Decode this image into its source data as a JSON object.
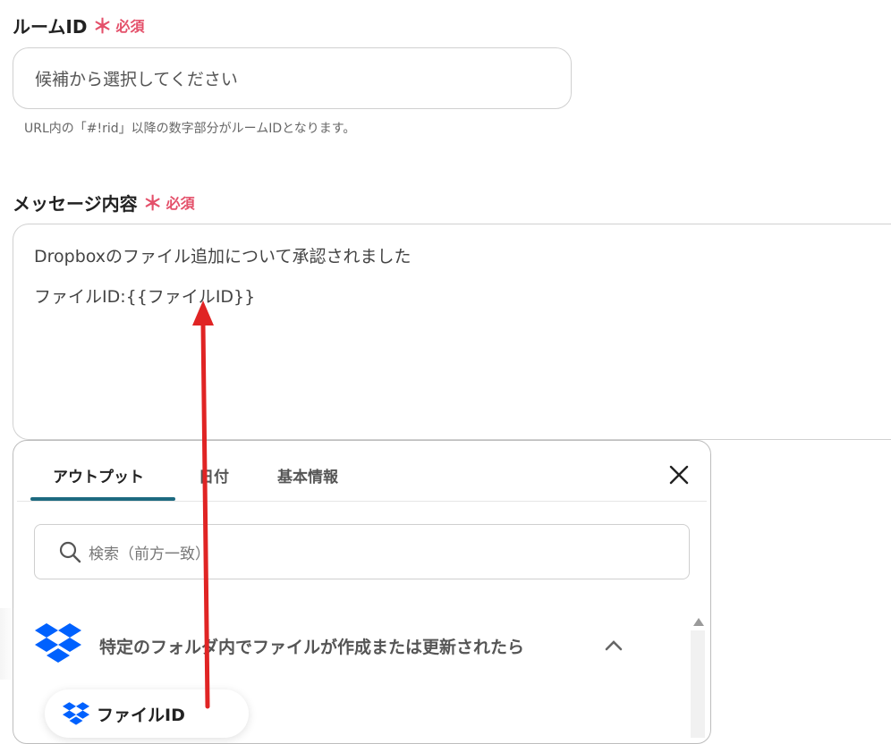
{
  "room_id": {
    "label": "ルームID",
    "required_star": "＊",
    "required_text": "必須",
    "placeholder": "候補から選択してください",
    "hint": "URL内の「#!rid」以降の数字部分がルームIDとなります。"
  },
  "message": {
    "label": "メッセージ内容",
    "required_star": "＊",
    "required_text": "必須",
    "lines": [
      "Dropboxのファイル追加について承認されました",
      "ファイルID:{{ファイルID}}"
    ]
  },
  "panel": {
    "tabs": [
      "アウトプット",
      "日付",
      "基本情報"
    ],
    "active_tab": "アウトプット",
    "search_placeholder": "検索（前方一致）",
    "group_title": "特定のフォルダ内でファイルが作成または更新されたら",
    "chip_label": "ファイルID"
  },
  "colors": {
    "required": "#e4506a",
    "tab_underline": "#1d6a80",
    "arrow": "#e02424",
    "dropbox": "#0061fe"
  },
  "icons": {
    "close": "close-icon",
    "search": "search-icon",
    "dropbox": "dropbox-icon",
    "chevron": "chevron-up-icon"
  }
}
